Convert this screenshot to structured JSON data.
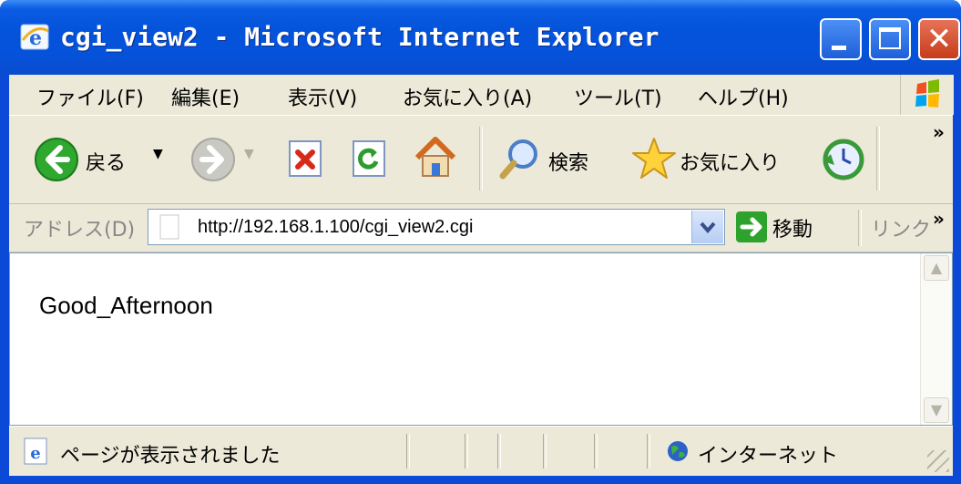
{
  "window": {
    "title": "cgi_view2 - Microsoft Internet Explorer",
    "controls": {
      "minimize": "minimize",
      "maximize": "maximize",
      "close": "✕"
    }
  },
  "menu": {
    "items": [
      {
        "label": "ファイル(F)"
      },
      {
        "label": "編集(E)"
      },
      {
        "label": "表示(V)"
      },
      {
        "label": "お気に入り(A)"
      },
      {
        "label": "ツール(T)"
      },
      {
        "label": "ヘルプ(H)"
      }
    ]
  },
  "toolbar": {
    "back_label": "戻る",
    "search_label": "検索",
    "favorites_label": "お気に入り",
    "overflow": "»"
  },
  "address": {
    "label": "アドレス(D)",
    "url": "http://192.168.1.100/cgi_view2.cgi",
    "go_label": "移動",
    "links_label": "リンク",
    "overflow": "»"
  },
  "content": {
    "text": "Good_Afternoon"
  },
  "status": {
    "text": "ページが表示されました",
    "zone": "インターネット"
  },
  "colors": {
    "titlebar": "#0453da",
    "chrome": "#ece9d8",
    "close_button": "#c63d1a",
    "go_button": "#2da32d"
  }
}
